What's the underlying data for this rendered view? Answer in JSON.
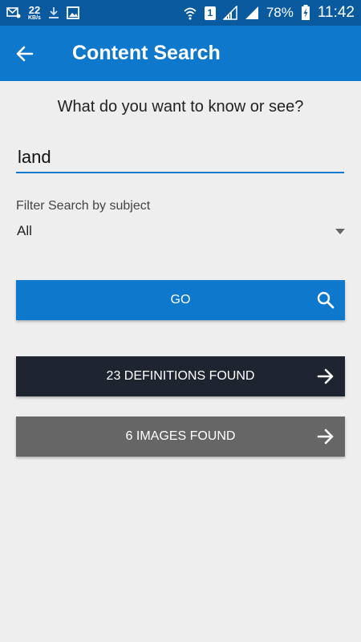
{
  "status_bar": {
    "net_speed_value": "22",
    "net_speed_unit": "KB/s",
    "sim_slot": "1",
    "battery_percent": "78%",
    "time": "11:42",
    "icons": [
      "mail-notification-icon",
      "download-icon",
      "image-icon",
      "wifi-icon",
      "signal-icon",
      "battery-charging-icon"
    ]
  },
  "app_bar": {
    "title": "Content Search",
    "back_icon": "arrow-left-icon"
  },
  "search": {
    "prompt": "What do you want to know or see?",
    "query": "land"
  },
  "filter": {
    "label": "Filter Search by subject",
    "selected": "All"
  },
  "actions": {
    "go_label": "GO",
    "definitions_label": "23 DEFINITIONS FOUND",
    "images_label": "6 IMAGES FOUND"
  },
  "colors": {
    "status_bar": "#0a5aa0",
    "app_bar": "#0e78cc",
    "go_button": "#0e78cc",
    "definitions_button": "#1f2530",
    "images_button": "#666666",
    "background": "#eeeeee"
  }
}
